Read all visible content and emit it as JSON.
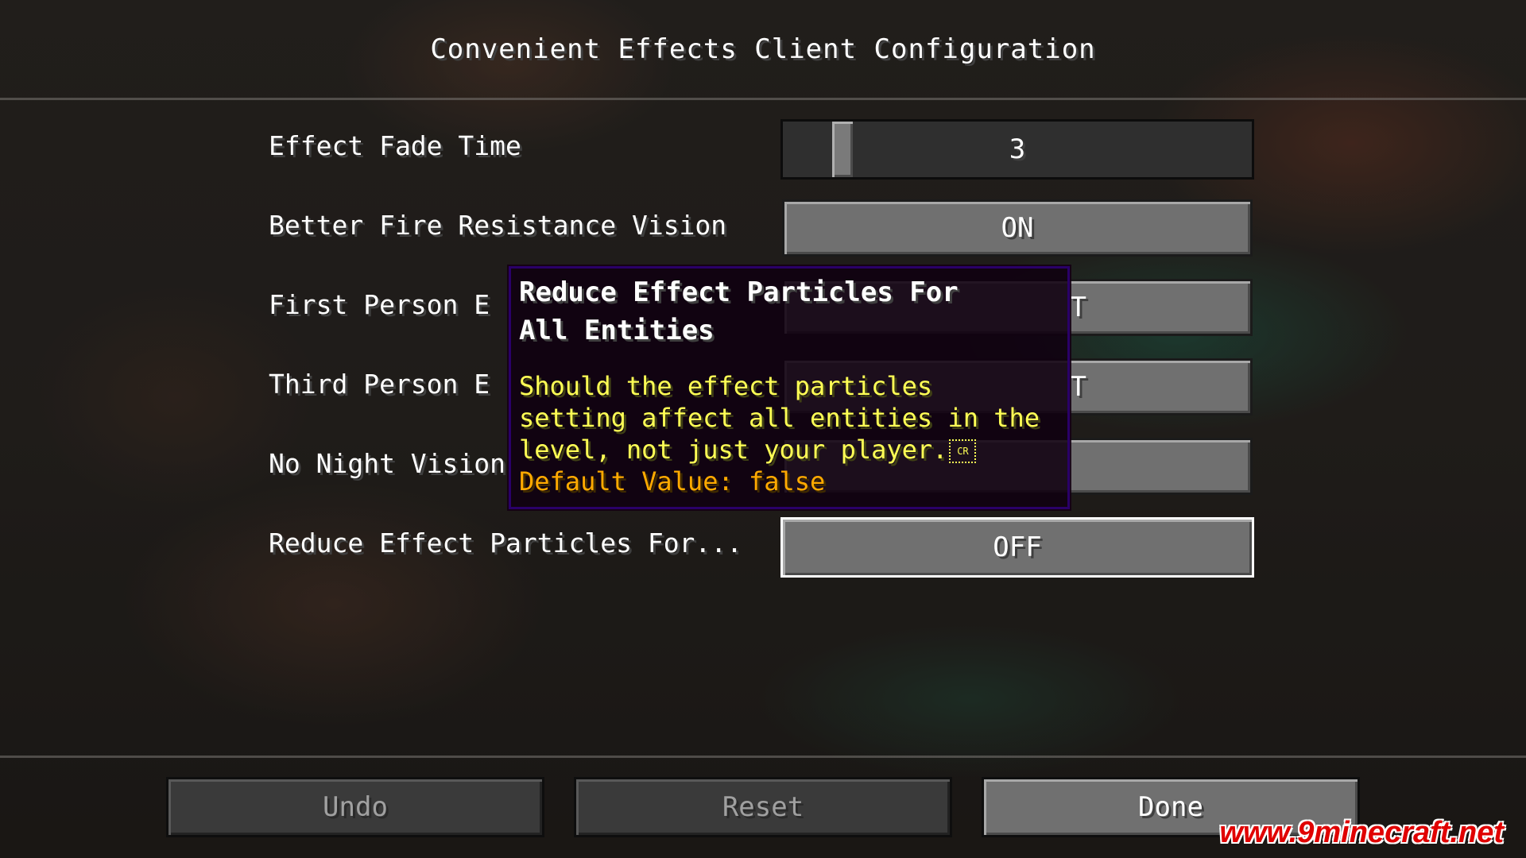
{
  "title": "Convenient Effects Client Configuration",
  "options": [
    {
      "label": "Effect Fade Time",
      "value": "3",
      "slider_fraction": 0.11
    },
    {
      "label": "Better Fire Resistance Vision",
      "value": "ON"
    },
    {
      "label": "First Person E",
      "value": "T"
    },
    {
      "label": "Third Person E",
      "value": "T"
    },
    {
      "label": "No Night Vision",
      "value": ""
    },
    {
      "label": "Reduce Effect Particles For...",
      "value": "OFF"
    }
  ],
  "tooltip": {
    "title_line1": "Reduce Effect Particles For",
    "title_line2": "All Entities",
    "desc_line1": "Should the effect particles",
    "desc_line2": "setting affect all entities in the",
    "desc_line3": "level, not just your player.",
    "cr_symbol": "CR",
    "default_value": "Default Value: false"
  },
  "footer": {
    "undo": "Undo",
    "reset": "Reset",
    "done": "Done"
  },
  "watermark": "www.9minecraft.net",
  "colors": {
    "tooltip_title": "#ffffff",
    "tooltip_desc": "#ffff55",
    "tooltip_default": "#ffaa00",
    "tooltip_border": "#2a0068",
    "watermark": "#e00000"
  }
}
